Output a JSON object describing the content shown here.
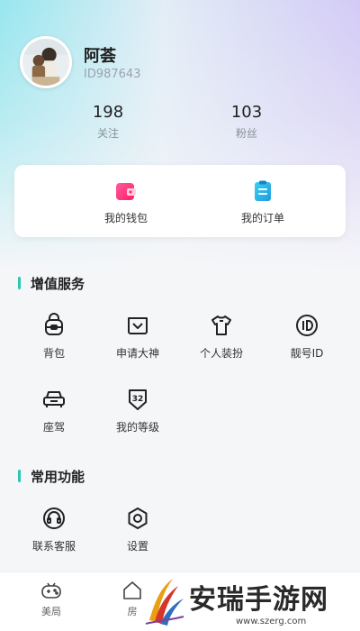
{
  "profile": {
    "name": "阿荟",
    "id_text": "ID987643"
  },
  "stats": {
    "following": {
      "value": "198",
      "label": "关注"
    },
    "fans": {
      "value": "103",
      "label": "粉丝"
    }
  },
  "quick_actions": {
    "wallet_label": "我的钱包",
    "orders_label": "我的订单"
  },
  "value_services": {
    "title": "增值服务",
    "items": [
      {
        "label": "背包",
        "icon": "backpack-icon"
      },
      {
        "label": "申请大神",
        "icon": "badge-box-icon"
      },
      {
        "label": "个人装扮",
        "icon": "tshirt-icon"
      },
      {
        "label": "靓号ID",
        "icon": "id-icon"
      },
      {
        "label": "座驾",
        "icon": "car-icon"
      },
      {
        "label": "我的等级",
        "icon": "level-shield-icon",
        "icon_text": "32"
      }
    ]
  },
  "common_functions": {
    "title": "常用功能",
    "items": [
      {
        "label": "联系客服",
        "icon": "headset-icon"
      },
      {
        "label": "设置",
        "icon": "gear-icon"
      }
    ]
  },
  "tabbar": {
    "items": [
      {
        "label": "美局",
        "icon": "gamepad-icon"
      },
      {
        "label": "房",
        "icon": "home-icon"
      }
    ]
  },
  "watermark": {
    "title": "安瑞手游网",
    "url": "www.szerg.com"
  },
  "colors": {
    "accent": "#2bc6b6",
    "wallet": "#ff2f7a",
    "orders": "#29b6e8"
  }
}
